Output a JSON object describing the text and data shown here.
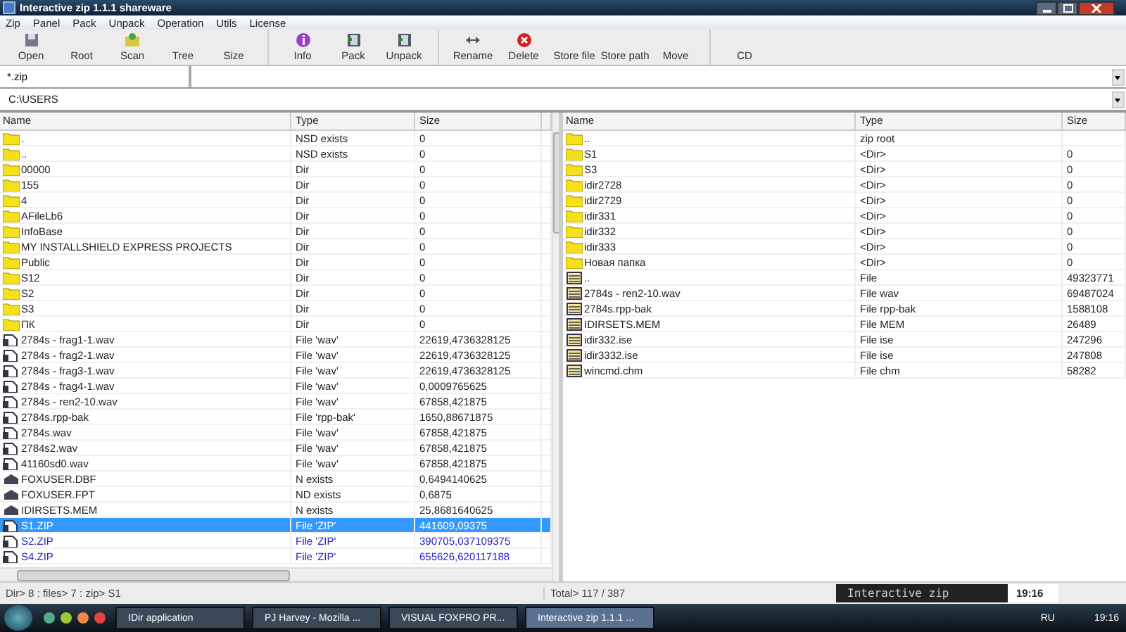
{
  "window": {
    "title": "Interactive zip 1.1.1 shareware"
  },
  "menu": [
    "Zip",
    "Panel",
    "Pack",
    "Unpack",
    "Operation",
    "Utils",
    "License"
  ],
  "toolbar": [
    {
      "label": "Open",
      "icon": true
    },
    {
      "label": "Root",
      "icon": false
    },
    {
      "label": "Scan",
      "icon": true
    },
    {
      "label": "Tree",
      "icon": false
    },
    {
      "label": "Size",
      "icon": false
    },
    {
      "label": "Info",
      "icon": true,
      "group_start": true
    },
    {
      "label": "Pack",
      "icon": true
    },
    {
      "label": "Unpack",
      "icon": true
    },
    {
      "label": "Rename",
      "icon": true,
      "group_start": true
    },
    {
      "label": "Delete",
      "icon": true
    },
    {
      "label": "Store file",
      "icon": false
    },
    {
      "label": "Store path",
      "icon": false
    },
    {
      "label": "Move",
      "icon": false
    },
    {
      "label": "CD",
      "icon": false,
      "group_start": true
    }
  ],
  "filter": {
    "value": "*.zip"
  },
  "path": {
    "value": "C:\\USERS"
  },
  "left_panel": {
    "columns": [
      "Name",
      "Type",
      "Size"
    ],
    "rows": [
      {
        "kind": "folder",
        "name": ".",
        "type": "NSD exists",
        "size": "0",
        "selected": false
      },
      {
        "kind": "folder",
        "name": "..",
        "type": "NSD exists",
        "size": "0",
        "selected": false
      },
      {
        "kind": "folder",
        "name": "00000",
        "type": "Dir",
        "size": "0",
        "selected": false
      },
      {
        "kind": "folder",
        "name": "155",
        "type": "Dir",
        "size": "0",
        "selected": false
      },
      {
        "kind": "folder",
        "name": "4",
        "type": "Dir",
        "size": "0",
        "selected": false
      },
      {
        "kind": "folder",
        "name": "AFileLb6",
        "type": "Dir",
        "size": "0",
        "selected": false
      },
      {
        "kind": "folder",
        "name": "InfoBase",
        "type": "Dir",
        "size": "0",
        "selected": false
      },
      {
        "kind": "folder",
        "name": "MY INSTALLSHIELD EXPRESS PROJECTS",
        "type": "Dir",
        "size": "0",
        "selected": false
      },
      {
        "kind": "folder",
        "name": "Public",
        "type": "Dir",
        "size": "0",
        "selected": false
      },
      {
        "kind": "folder",
        "name": "S12",
        "type": "Dir",
        "size": "0",
        "selected": false
      },
      {
        "kind": "folder",
        "name": "S2",
        "type": "Dir",
        "size": "0",
        "selected": false
      },
      {
        "kind": "folder",
        "name": "S3",
        "type": "Dir",
        "size": "0",
        "selected": false
      },
      {
        "kind": "folder",
        "name": "ПК",
        "type": "Dir",
        "size": "0",
        "selected": false
      },
      {
        "kind": "file",
        "name": "2784s - frag1-1.wav",
        "type": "File 'wav'",
        "size": "22619,4736328125",
        "selected": false
      },
      {
        "kind": "file",
        "name": "2784s - frag2-1.wav",
        "type": "File 'wav'",
        "size": "22619,4736328125",
        "selected": false
      },
      {
        "kind": "file",
        "name": "2784s - frag3-1.wav",
        "type": "File 'wav'",
        "size": "22619,4736328125",
        "selected": false
      },
      {
        "kind": "file",
        "name": "2784s - frag4-1.wav",
        "type": "File 'wav'",
        "size": "0,0009765625",
        "selected": false
      },
      {
        "kind": "file",
        "name": "2784s - ren2-10.wav",
        "type": "File 'wav'",
        "size": "67858,421875",
        "selected": false
      },
      {
        "kind": "file",
        "name": "2784s.rpp-bak",
        "type": "File 'rpp-bak'",
        "size": "1650,88671875",
        "selected": false
      },
      {
        "kind": "file",
        "name": "2784s.wav",
        "type": "File 'wav'",
        "size": "67858,421875",
        "selected": false
      },
      {
        "kind": "file",
        "name": "2784s2.wav",
        "type": "File 'wav'",
        "size": "67858,421875",
        "selected": false
      },
      {
        "kind": "file",
        "name": "41160sd0.wav",
        "type": "File 'wav'",
        "size": "67858,421875",
        "selected": false
      },
      {
        "kind": "data",
        "name": "FOXUSER.DBF",
        "type": "N exists",
        "size": "0,6494140625",
        "selected": false
      },
      {
        "kind": "data",
        "name": "FOXUSER.FPT",
        "type": "ND exists",
        "size": "0,6875",
        "selected": false
      },
      {
        "kind": "data",
        "name": "IDIRSETS.MEM",
        "type": "N exists",
        "size": "25,8681640625",
        "selected": false
      },
      {
        "kind": "archive",
        "name": "S1.ZIP",
        "type": "File 'ZIP'",
        "size": "441609,09375",
        "selected": true
      },
      {
        "kind": "archive",
        "name": "S2.ZIP",
        "type": "File 'ZIP'",
        "size": "390705,037109375",
        "selected": false
      },
      {
        "kind": "archive",
        "name": "S4.ZIP",
        "type": "File 'ZIP'",
        "size": "655626,620117188",
        "selected": false
      }
    ]
  },
  "right_panel": {
    "columns": [
      "Name",
      "Type",
      "Size"
    ],
    "rows": [
      {
        "kind": "folder",
        "name": "..",
        "type": "zip root",
        "size": ""
      },
      {
        "kind": "folder",
        "name": "S1",
        "type": "<Dir>",
        "size": "0"
      },
      {
        "kind": "folder",
        "name": "S3",
        "type": "<Dir>",
        "size": "0"
      },
      {
        "kind": "folder",
        "name": "idir2728",
        "type": "<Dir>",
        "size": "0"
      },
      {
        "kind": "folder",
        "name": "idir2729",
        "type": "<Dir>",
        "size": "0"
      },
      {
        "kind": "folder",
        "name": "idir331",
        "type": "<Dir>",
        "size": "0"
      },
      {
        "kind": "folder",
        "name": "idir332",
        "type": "<Dir>",
        "size": "0"
      },
      {
        "kind": "folder",
        "name": "idir333",
        "type": "<Dir>",
        "size": "0"
      },
      {
        "kind": "folder",
        "name": "Новая папка",
        "type": "<Dir>",
        "size": "0"
      },
      {
        "kind": "packed",
        "name": "..",
        "type": "File",
        "size": "49323771"
      },
      {
        "kind": "packed",
        "name": "2784s - ren2-10.wav",
        "type": "File wav",
        "size": "69487024"
      },
      {
        "kind": "packed",
        "name": "2784s.rpp-bak",
        "type": "File rpp-bak",
        "size": "1588108"
      },
      {
        "kind": "packed",
        "name": "IDIRSETS.MEM",
        "type": "File MEM",
        "size": "26489"
      },
      {
        "kind": "packed",
        "name": "idir332.ise",
        "type": "File ise",
        "size": "247296"
      },
      {
        "kind": "packed",
        "name": "idir3332.ise",
        "type": "File ise",
        "size": "247808"
      },
      {
        "kind": "packed",
        "name": "wincmd.chm",
        "type": "File chm",
        "size": "58282"
      }
    ]
  },
  "status_bar": {
    "left": "Dir> 8 : files> 7 : zip> S1",
    "right": "Total> 117 / 387",
    "banner": "Interactive zip",
    "time": "19:16"
  },
  "taskbar": {
    "tasks": [
      {
        "label": "IDir application",
        "selected": false
      },
      {
        "label": "PJ Harvey - Mozilla ...",
        "selected": false
      },
      {
        "label": "VISUAL FOXPRO PR...",
        "selected": false
      },
      {
        "label": "Interactive zip 1.1.1 ...",
        "selected": true
      }
    ],
    "language": "RU",
    "time": "19:16"
  }
}
